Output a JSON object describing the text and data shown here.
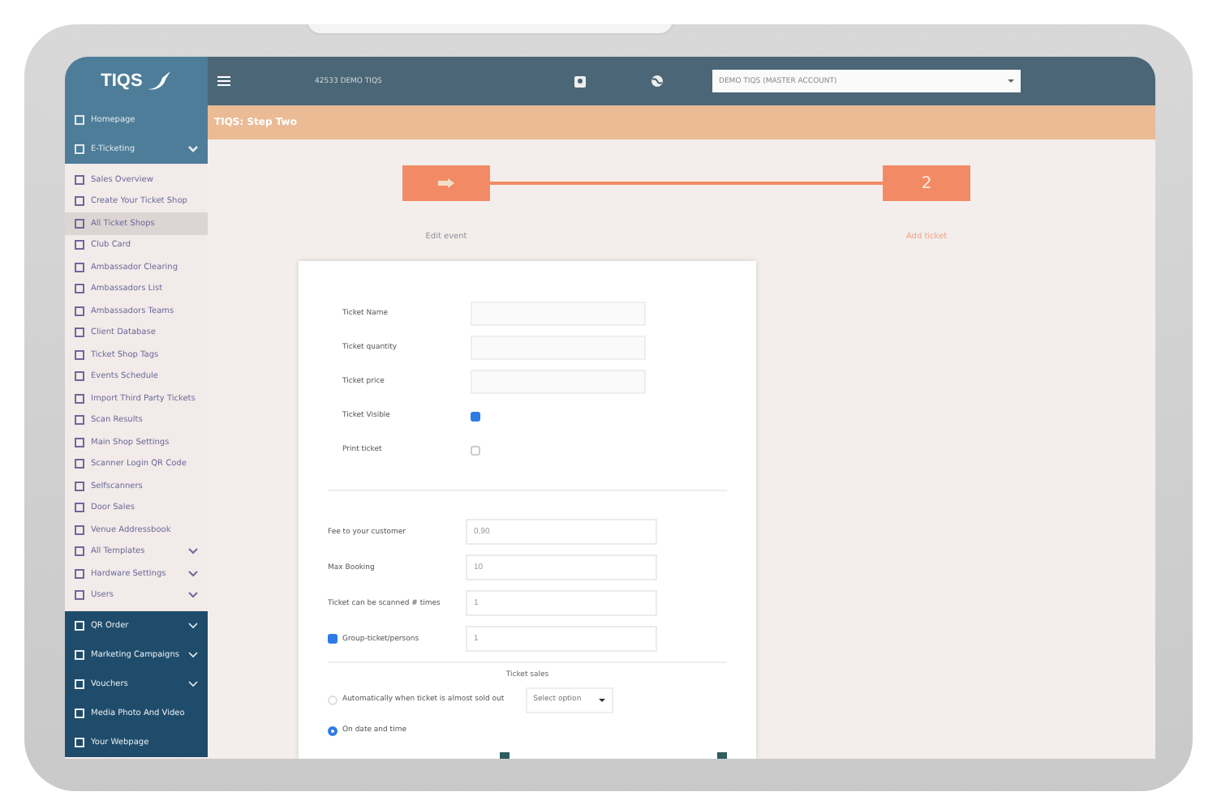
{
  "topbar": {
    "account_id": "42533 DEMO TIQS",
    "account_select": "DEMO TIQS (MASTER ACCOUNT)"
  },
  "sidebar": {
    "logo": "TIQS",
    "items": [
      {
        "label": "Homepage",
        "kind": "link"
      },
      {
        "label": "E-Ticketing",
        "kind": "group",
        "expanded": true,
        "children": [
          {
            "label": "Sales Overview",
            "kind": "link",
            "selected": false
          },
          {
            "label": "Create Your Ticket Shop",
            "kind": "link",
            "selected": false
          },
          {
            "label": "All Ticket Shops",
            "kind": "link",
            "selected": true
          },
          {
            "label": "Club Card",
            "kind": "link",
            "selected": false
          },
          {
            "label": "Ambassador Clearing",
            "kind": "link",
            "selected": false
          },
          {
            "label": "Ambassadors List",
            "kind": "link",
            "selected": false
          },
          {
            "label": "Ambassadors Teams",
            "kind": "link",
            "selected": false
          },
          {
            "label": "Client Database",
            "kind": "link",
            "selected": false
          },
          {
            "label": "Ticket Shop Tags",
            "kind": "link",
            "selected": false
          },
          {
            "label": "Events Schedule",
            "kind": "link",
            "selected": false
          },
          {
            "label": "Import Third Party Tickets",
            "kind": "link",
            "selected": false
          },
          {
            "label": "Scan Results",
            "kind": "link",
            "selected": false
          },
          {
            "label": "Main Shop Settings",
            "kind": "link",
            "selected": false
          },
          {
            "label": "Scanner Login QR Code",
            "kind": "link",
            "selected": false
          },
          {
            "label": "Selfscanners",
            "kind": "link",
            "selected": false
          },
          {
            "label": "Door Sales",
            "kind": "link",
            "selected": false
          },
          {
            "label": "Venue Addressbook",
            "kind": "link",
            "selected": false
          },
          {
            "label": "All Templates",
            "kind": "group",
            "selected": false
          },
          {
            "label": "Hardware Settings",
            "kind": "group",
            "selected": false
          },
          {
            "label": "Users",
            "kind": "group",
            "selected": false
          }
        ]
      },
      {
        "label": "QR Order",
        "kind": "group",
        "expanded": false
      },
      {
        "label": "Marketing Campaigns",
        "kind": "group",
        "expanded": false
      },
      {
        "label": "Vouchers",
        "kind": "group",
        "expanded": false
      },
      {
        "label": "Media Photo And Video",
        "kind": "link"
      },
      {
        "label": "Your Webpage",
        "kind": "link"
      }
    ]
  },
  "page_title": "TIQS: Step Two",
  "steps": [
    {
      "label": "Edit event",
      "done": true,
      "selected": false
    },
    {
      "label": "Add ticket",
      "number": "2",
      "done": false,
      "selected": true
    }
  ],
  "ticket_fields": [
    {
      "label": "Ticket Name",
      "kind": "text"
    },
    {
      "label": "Ticket quantity",
      "kind": "text"
    },
    {
      "label": "Ticket price",
      "kind": "text"
    },
    {
      "label": "Ticket Visible",
      "kind": "checkbox",
      "checked": true
    },
    {
      "label": "Print ticket",
      "kind": "checkbox",
      "checked": false
    }
  ],
  "booking_fields": [
    {
      "label": "Fee to your customer",
      "kind": "text",
      "value": "0,90"
    },
    {
      "label": "Max Booking",
      "kind": "text",
      "value": "10"
    },
    {
      "label": "Ticket can be scanned # times",
      "kind": "text",
      "value": "1"
    },
    {
      "label": "Group-ticket/persons",
      "kind": "checked-text",
      "checked": true,
      "value": "1"
    }
  ],
  "ticket_sales": {
    "title": "Ticket sales",
    "options": [
      {
        "label": "Automatically when ticket is almost sold out",
        "selected": false,
        "select": "Select option"
      },
      {
        "label": "On date and time",
        "selected": true
      }
    ]
  }
}
